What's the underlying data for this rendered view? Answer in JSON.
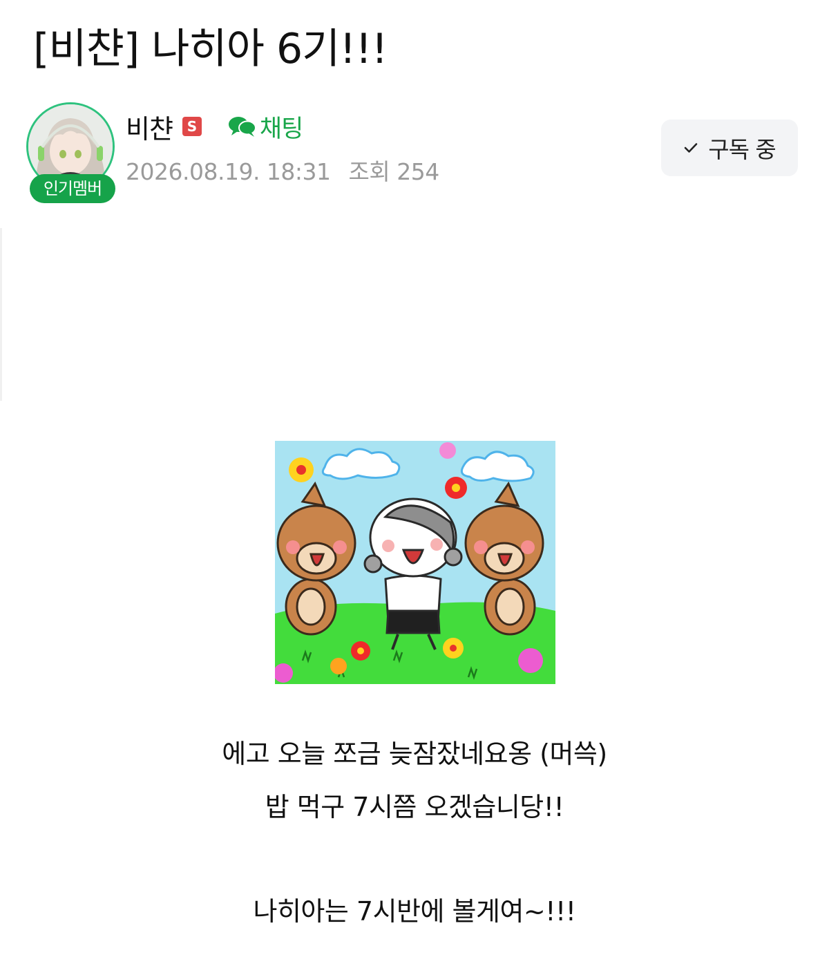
{
  "post": {
    "title": "[비챤] 나히아 6기!!!"
  },
  "author": {
    "name": "비챤",
    "level_badge": "S",
    "popular_badge": "인기멤버",
    "chat_label": "채팅",
    "date": "2026.08.19. 18:31",
    "views": "조회 254"
  },
  "subscribe": {
    "label": "구독 중"
  },
  "content": {
    "lines": [
      "에고 오늘 쪼금 늦잠잤네요옹 (머쓱)",
      "밥 먹구 7시쯤 오겠습니당!!",
      "나히아는 7시반에 볼게여~!!!"
    ]
  },
  "colors": {
    "accent_green": "#19a64a",
    "badge_red": "#e04848",
    "meta_gray": "#9a9a9a"
  },
  "icons": [
    "chat-bubble-icon",
    "check-icon"
  ]
}
